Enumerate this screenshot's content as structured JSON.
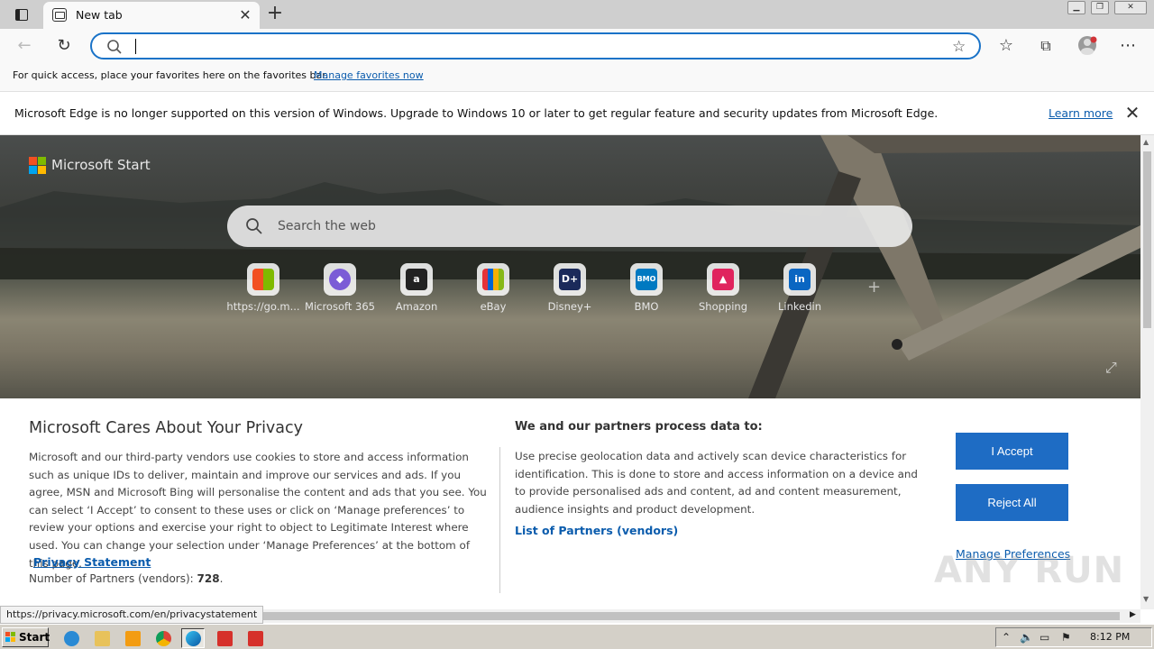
{
  "browser": {
    "tab_title": "New tab",
    "address_value": "",
    "favorites_bar_message": "For quick access, place your favorites here on the favorites bar.",
    "favorites_bar_link": "Manage favorites now",
    "info_message": "Microsoft Edge is no longer supported on this version of Windows. Upgrade to Windows 10 or later to get regular feature and security updates from Microsoft Edge.",
    "info_link": "Learn more",
    "status_url": "https://privacy.microsoft.com/en/privacystatement"
  },
  "newtab": {
    "brand": "Microsoft Start",
    "search_placeholder": "Search the web",
    "quick_links": [
      {
        "label": "https://go.m...",
        "icon": "windows-tiles-icon",
        "color": "#f25022"
      },
      {
        "label": "Microsoft 365",
        "icon": "m365-icon",
        "color": "#7b5cd6"
      },
      {
        "label": "Amazon",
        "icon": "amazon-icon",
        "color": "#222222"
      },
      {
        "label": "eBay",
        "icon": "ebay-bag-icon",
        "color": "#333333"
      },
      {
        "label": "Disney+",
        "icon": "disney-icon",
        "color": "#1b2a5a"
      },
      {
        "label": "BMO",
        "icon": "bmo-icon",
        "color": "#0079c1"
      },
      {
        "label": "Shopping",
        "icon": "shopping-bag-icon",
        "color": "#e0245e"
      },
      {
        "label": "Linkedin",
        "icon": "linkedin-icon",
        "color": "#0a66c2"
      }
    ]
  },
  "privacy": {
    "title": "Microsoft Cares About Your Privacy",
    "body": "Microsoft and our third-party vendors use cookies to store and access information such as unique IDs to deliver, maintain and improve our services and ads. If you agree, MSN and Microsoft Bing will personalise the content and ads that you see. You can select ‘I Accept’ to consent to these uses or click on ‘Manage preferences’ to review your options and exercise your right to object to Legitimate Interest where used.  You can change your selection under ‘Manage Preferences’ at the bottom of this page.",
    "statement_link": "Privacy Statement",
    "partners_label": "Number of Partners (vendors):",
    "partners_count": "728",
    "right_title": "We and our partners process data to:",
    "right_body": "Use precise geolocation data and actively scan device characteristics for identification. This is done to store and access information on a device and to provide personalised ads and content, ad and content measurement, audience insights and product development.",
    "vendors_link": "List of Partners (vendors)",
    "accept_label": "I Accept",
    "reject_label": "Reject All",
    "manage_label": "Manage Preferences"
  },
  "taskbar": {
    "start_label": "Start",
    "clock": "8:12 PM"
  },
  "watermark": "ANY RUN",
  "colors": {
    "accent": "#1e6cc4",
    "link": "#0b5cad"
  }
}
